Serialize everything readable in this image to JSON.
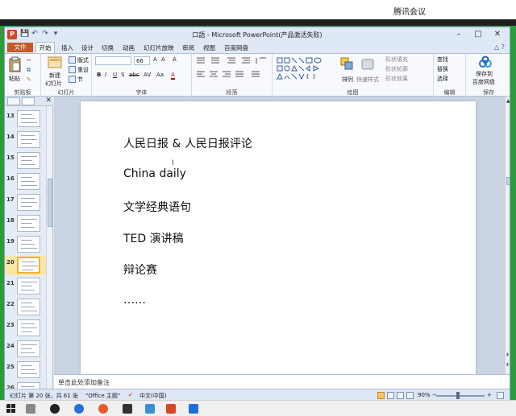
{
  "meeting": {
    "title": "腾讯会议"
  },
  "window": {
    "title": "口語 - Microsoft PowerPoint(产品激活失败)",
    "minimize": "–",
    "maximize": "□",
    "close": "✕"
  },
  "qat": {
    "save": "💾",
    "undo": "↶",
    "redo": "↷",
    "more": "▾"
  },
  "menu": {
    "file": "文件",
    "tabs": [
      "开始",
      "插入",
      "设计",
      "切换",
      "动画",
      "幻灯片放映",
      "审阅",
      "视图",
      "百度网盘"
    ],
    "right": "△ ?"
  },
  "ribbon": {
    "clipboard": {
      "label": "剪贴板",
      "paste": "粘贴"
    },
    "slides": {
      "label": "幻灯片",
      "new_slide": "新建",
      "new_slide2": "幻灯片",
      "layout": "版式",
      "reset": "重设",
      "section": "节"
    },
    "font": {
      "label": "字体",
      "font_size": "66",
      "bold": "B",
      "italic": "I",
      "underline": "U",
      "strike": "S",
      "abc": "abc",
      "av": "AV",
      "aa": "Aa",
      "a": "A"
    },
    "paragraph": {
      "label": "段落"
    },
    "drawing": {
      "label": "绘图",
      "arrange": "排列",
      "quick_styles": "快速样式",
      "fill": "形状填充",
      "outline": "形状轮廓",
      "effects": "形状效果"
    },
    "editing": {
      "label": "编辑",
      "find": "查找",
      "replace": "替换",
      "select": "选择"
    },
    "save": {
      "label": "保存",
      "save_to": "保存到",
      "baidu": "百度网盘"
    }
  },
  "thumbnails": [
    {
      "num": "13",
      "active": false
    },
    {
      "num": "14",
      "active": false
    },
    {
      "num": "15",
      "active": false
    },
    {
      "num": "16",
      "active": false
    },
    {
      "num": "17",
      "active": false
    },
    {
      "num": "18",
      "active": false
    },
    {
      "num": "19",
      "active": false
    },
    {
      "num": "20",
      "active": true
    },
    {
      "num": "21",
      "active": false
    },
    {
      "num": "22",
      "active": false
    },
    {
      "num": "23",
      "active": false
    },
    {
      "num": "24",
      "active": false
    },
    {
      "num": "25",
      "active": false
    },
    {
      "num": "26",
      "active": false
    }
  ],
  "slide": {
    "lines": [
      "人民日报 & 人民日报评论",
      "China daily",
      "文学经典语句",
      "TED 演讲稿",
      "辩论赛",
      "……"
    ]
  },
  "notes": {
    "placeholder": "单击此处添加备注"
  },
  "status": {
    "slide_info": "幻灯片 第 20 张，共 61 张",
    "theme": "\"Office 主题\"",
    "language": "中文(中国)",
    "zoom": "90%",
    "zoom_out": "−",
    "zoom_in": "+"
  },
  "colors": {
    "accent": "#c55a28",
    "active_thumb": "#f2b136"
  }
}
